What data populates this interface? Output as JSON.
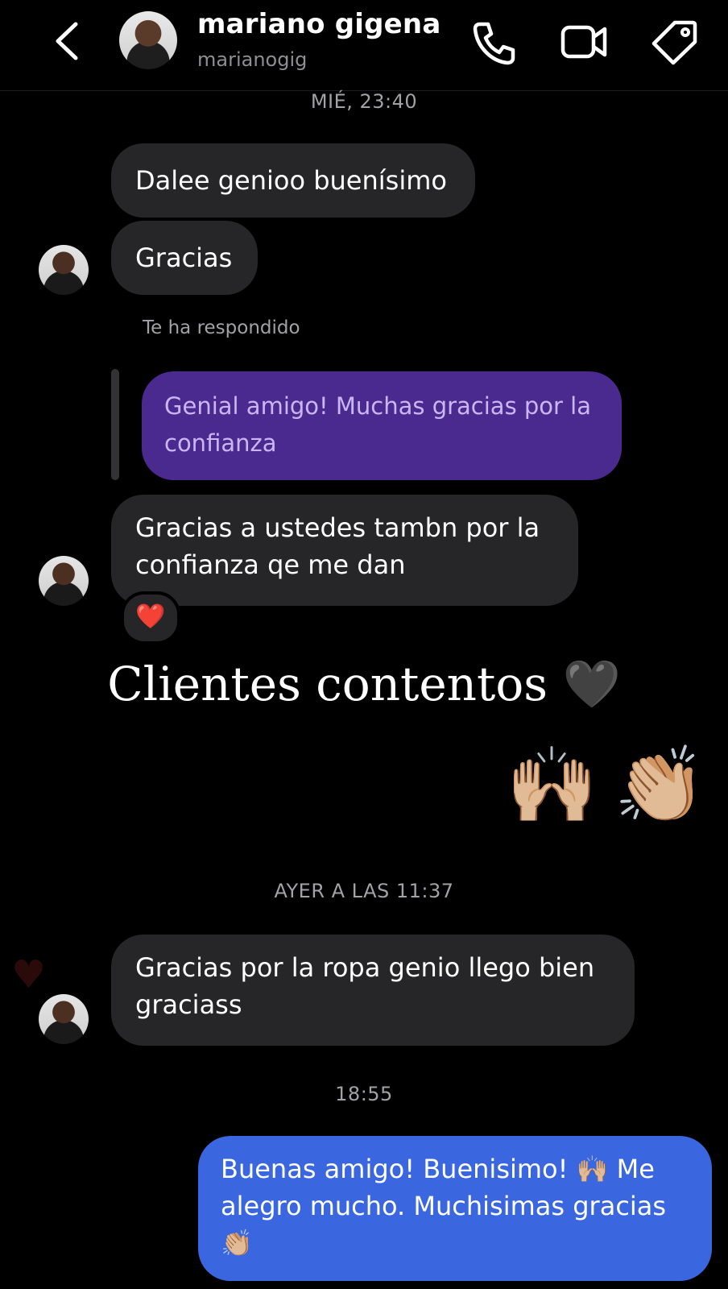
{
  "header": {
    "name": "mariano gigena",
    "username": "marianogig",
    "icons": [
      "back-chevron-icon",
      "phone-icon",
      "video-camera-icon",
      "tag-icon"
    ]
  },
  "timestamps": {
    "first": "MIÉ, 23:40",
    "second": "AYER A LAS 11:37",
    "third": "18:55"
  },
  "messages": {
    "m1": "Dalee genioo buenísimo",
    "m2": "Gracias",
    "reply_label": "Te ha respondido",
    "reply_quote": "Genial amigo! Muchas gracias por la confianza",
    "m3": "Gracias a ustedes tambn por la confianza qe me dan",
    "reaction": "❤️",
    "m4": "Gracias por la ropa genio llego bien graciass",
    "own": "Buenas amigo! Buenisimo! 🙌🏼 Me alegro mucho. Muchisimas gracias 👏🏼"
  },
  "overlay": {
    "caption": "Clientes contentos 🖤",
    "emoji_left": "🙌🏼",
    "emoji_right": "👏🏼"
  },
  "colors": {
    "background": "#000000",
    "incoming_bubble": "#262628",
    "reply_bubble": "#4b2a8f",
    "outgoing_bubble": "#3a66e0"
  }
}
